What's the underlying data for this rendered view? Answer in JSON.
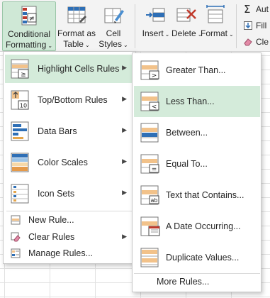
{
  "ribbon": {
    "conditional_formatting": {
      "line1": "Conditional",
      "line2": "Formatting"
    },
    "format_as_table": {
      "line1": "Format as",
      "line2": "Table"
    },
    "cell_styles": {
      "line1": "Cell",
      "line2": "Styles"
    },
    "insert": "Insert",
    "delete": "Delete",
    "format": "Format",
    "autosum": "Aut",
    "fill": "Fill",
    "clear": "Cle",
    "caret": "⌄"
  },
  "main_menu": {
    "items": [
      {
        "label": "Highlight Cells Rules",
        "icon": "highlight-cells-icon",
        "has_submenu": true,
        "highlighted": true
      },
      {
        "label": "Top/Bottom Rules",
        "icon": "top-bottom-icon",
        "has_submenu": true
      },
      {
        "label": "Data Bars",
        "icon": "data-bars-icon",
        "has_submenu": true
      },
      {
        "label": "Color Scales",
        "icon": "color-scales-icon",
        "has_submenu": true
      },
      {
        "label": "Icon Sets",
        "icon": "icon-sets-icon",
        "has_submenu": true
      }
    ],
    "small_items": [
      {
        "label": "New Rule...",
        "icon": "new-rule-icon"
      },
      {
        "label": "Clear Rules",
        "icon": "clear-rules-icon",
        "has_submenu": true
      },
      {
        "label": "Manage Rules...",
        "icon": "manage-rules-icon"
      }
    ],
    "submenu_arrow": "▶"
  },
  "submenu": {
    "items": [
      {
        "label": "Greater Than...",
        "icon": "greater-than-icon"
      },
      {
        "label": "Less Than...",
        "icon": "less-than-icon",
        "highlighted": true
      },
      {
        "label": "Between...",
        "icon": "between-icon"
      },
      {
        "label": "Equal To...",
        "icon": "equal-to-icon"
      },
      {
        "label": "Text that Contains...",
        "icon": "text-contains-icon"
      },
      {
        "label": "A Date Occurring...",
        "icon": "date-occurring-icon"
      },
      {
        "label": "Duplicate Values...",
        "icon": "duplicate-values-icon"
      }
    ],
    "more_rules": "More Rules..."
  },
  "colors": {
    "accent_green": "#d4ebda",
    "ribbon_bg": "#f3f3f3",
    "icon_blue": "#2e6fb6",
    "icon_orange": "#e5a54a",
    "icon_red": "#c0392b"
  }
}
